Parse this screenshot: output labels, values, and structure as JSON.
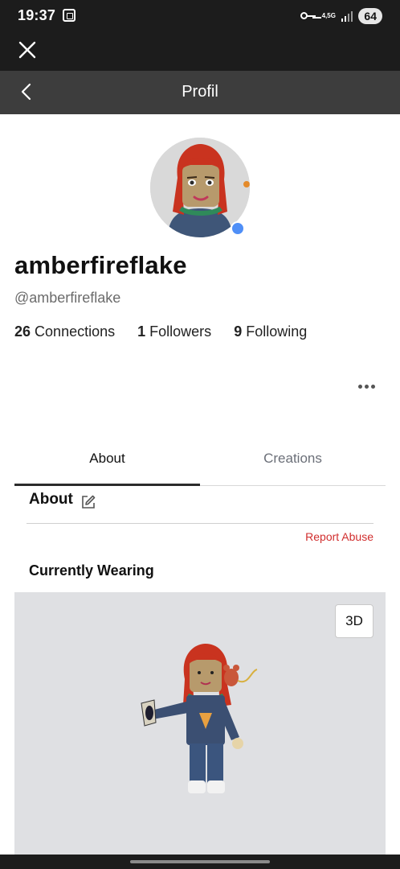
{
  "status_bar": {
    "time": "19:37",
    "network": "4,5G",
    "battery": "64"
  },
  "nav": {
    "title": "Profil"
  },
  "profile": {
    "display_name": "amberfireflake",
    "username": "@amberfireflake",
    "stats": [
      {
        "count": "26",
        "label": "Connections"
      },
      {
        "count": "1",
        "label": "Followers"
      },
      {
        "count": "9",
        "label": "Following"
      }
    ]
  },
  "tabs": [
    {
      "label": "About",
      "active": true
    },
    {
      "label": "Creations",
      "active": false
    }
  ],
  "about": {
    "heading": "About",
    "report_label": "Report Abuse",
    "wearing_heading": "Currently Wearing",
    "view_3d_label": "3D"
  },
  "colors": {
    "presence": "#4f8ff7",
    "report": "#d12e2e",
    "nav_bar": "#3d3d3d"
  }
}
